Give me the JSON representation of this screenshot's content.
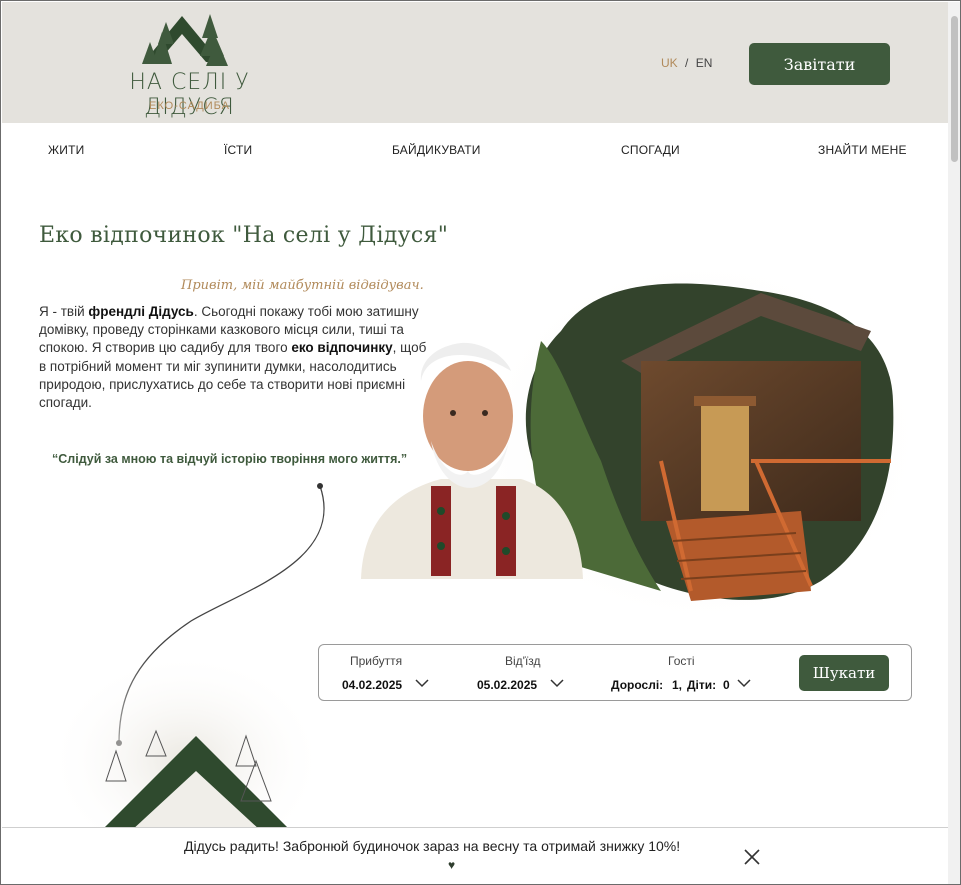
{
  "header": {
    "logo_title": "НА СЕЛІ У ДІДУСЯ",
    "logo_subtitle": "ЕКО-САДИБА",
    "lang_uk": "UK",
    "lang_sep": "/",
    "lang_en": "EN",
    "visit_label": "Завітати"
  },
  "nav": {
    "items": [
      {
        "label": "ЖИТИ"
      },
      {
        "label": "ЇСТИ"
      },
      {
        "label": "БАЙДИКУВАТИ"
      },
      {
        "label": "СПОГАДИ"
      },
      {
        "label": "ЗНАЙТИ МЕНЕ"
      }
    ]
  },
  "main": {
    "title": "Еко відпочинок \"На селі у Дідуся\"",
    "greeting": "Привіт, мій майбутній відвідувач.",
    "intro_part1": "Я - твій ",
    "intro_bold1": "френдлі Дідусь",
    "intro_part2": ". Сьогодні покажу тобі мою затишну домівку, проведу сторінками казкового місця сили, тиші та спокою. Я створив цю садибу для твого ",
    "intro_bold2": "еко відпочинку",
    "intro_part3": ", щоб в потрібний момент ти міг зупинити думки, насолодитись природою, прислухатись до себе та створити нові приємні спогади.",
    "quote": "“Слідуй за мною та відчуй історію творіння мого життя.”"
  },
  "booking": {
    "arrival_label": "Прибуття",
    "arrival_value": "04.02.2025",
    "departure_label": "Від'їзд",
    "departure_value": "05.02.2025",
    "guests_label": "Гості",
    "adults_label": "Дорослі:",
    "adults_value": "1,",
    "children_label": "Діти:",
    "children_value": "0",
    "search_label": "Шукати"
  },
  "promo": {
    "text": "Дідусь радить! Забронюй будиночок зараз на весну та отримай знижку 10%!"
  },
  "colors": {
    "brand_green": "#3f5a3d",
    "accent_gold": "#b18a5a",
    "header_bg": "#e4e2dd"
  }
}
